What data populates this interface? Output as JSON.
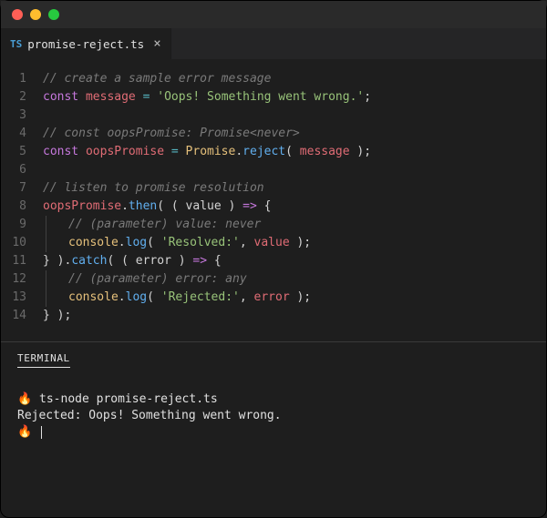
{
  "tab": {
    "icon_label": "TS",
    "filename": "promise-reject.ts",
    "close_glyph": "×"
  },
  "editor": {
    "line_numbers": [
      "1",
      "2",
      "3",
      "4",
      "5",
      "6",
      "7",
      "8",
      "9",
      "10",
      "11",
      "12",
      "13",
      "14"
    ],
    "lines": {
      "l1_comment": "// create a sample error message",
      "l2_const": "const",
      "l2_var": "message",
      "l2_eq": "=",
      "l2_str": "'Oops! Something went wrong.'",
      "l2_semi": ";",
      "l4_comment": "// const oopsPromise: Promise<never>",
      "l5_const": "const",
      "l5_var": "oopsPromise",
      "l5_eq": "=",
      "l5_class": "Promise",
      "l5_dot": ".",
      "l5_func": "reject",
      "l5_open": "( ",
      "l5_arg": "message",
      "l5_close": " );",
      "l7_comment": "// listen to promise resolution",
      "l8_obj": "oopsPromise",
      "l8_dot1": ".",
      "l8_then": "then",
      "l8_open": "( ( ",
      "l8_param": "value",
      "l8_mid": " ) ",
      "l8_arrow": "=>",
      "l8_brace": " {",
      "l9_comment": "// (parameter) value: never",
      "l10_console": "console",
      "l10_dot": ".",
      "l10_log": "log",
      "l10_open": "( ",
      "l10_str": "'Resolved:'",
      "l10_comma": ", ",
      "l10_arg": "value",
      "l10_close": " );",
      "l11_close1": "} ).",
      "l11_catch": "catch",
      "l11_open": "( ( ",
      "l11_param": "error",
      "l11_mid": " ) ",
      "l11_arrow": "=>",
      "l11_brace": " {",
      "l12_comment": "// (parameter) error: any",
      "l13_console": "console",
      "l13_dot": ".",
      "l13_log": "log",
      "l13_open": "( ",
      "l13_str": "'Rejected:'",
      "l13_comma": ", ",
      "l13_arg": "error",
      "l13_close": " );",
      "l14_close": "} );"
    }
  },
  "terminal": {
    "header": "TERMINAL",
    "prompt": "🔥",
    "cmd": "ts-node promise-reject.ts",
    "output": "Rejected: Oops! Something went wrong."
  }
}
